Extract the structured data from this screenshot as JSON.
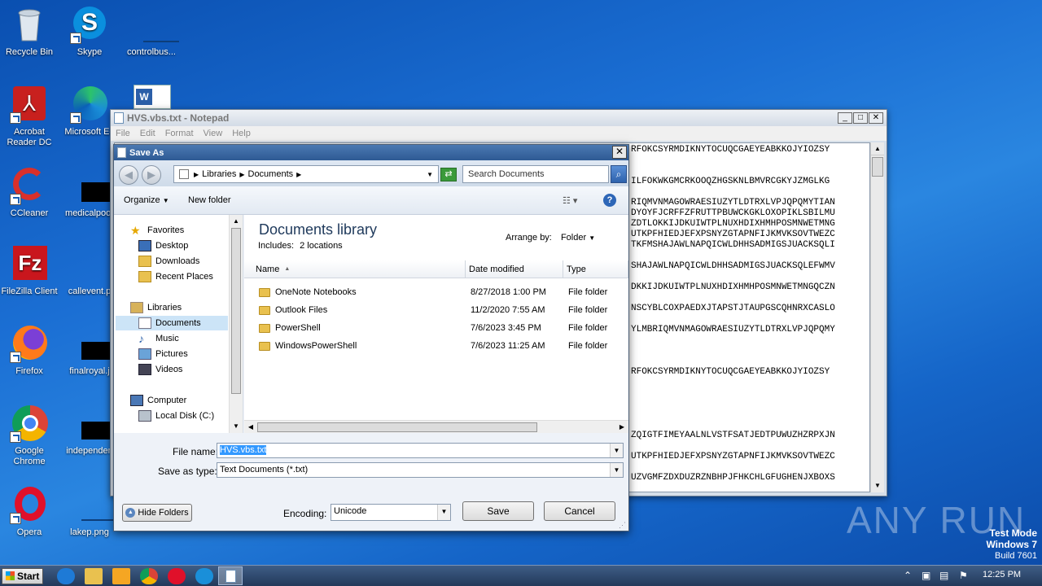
{
  "desktop": {
    "icons": [
      {
        "label": "Recycle Bin",
        "icon": "recycle-bin-icon"
      },
      {
        "label": "Skype",
        "icon": "skype-icon"
      },
      {
        "label": "controlbus...",
        "icon": "file-icon"
      },
      {
        "label": "Acrobat Reader DC",
        "icon": "acrobat-icon"
      },
      {
        "label": "Microsoft Ed",
        "icon": "edge-icon"
      },
      {
        "label": "CCleaner",
        "icon": "ccleaner-icon"
      },
      {
        "label": "medicalpoor",
        "icon": "file-icon"
      },
      {
        "label": "FileZilla Client",
        "icon": "filezilla-icon"
      },
      {
        "label": "callevent.p",
        "icon": "file-icon"
      },
      {
        "label": "Firefox",
        "icon": "firefox-icon"
      },
      {
        "label": "finalroyal.j",
        "icon": "file-icon"
      },
      {
        "label": "Google Chrome",
        "icon": "chrome-icon"
      },
      {
        "label": "independen",
        "icon": "file-icon"
      },
      {
        "label": "Opera",
        "icon": "opera-icon"
      },
      {
        "label": "lakep.png",
        "icon": "file-icon"
      }
    ],
    "watermark": {
      "brand": "ANY RUN",
      "line1": "Test Mode",
      "line2": "Windows 7",
      "line3": "Build 7601"
    }
  },
  "notepad": {
    "title": "HVS.vbs.txt - Notepad",
    "menu": [
      "File",
      "Edit",
      "Format",
      "View",
      "Help"
    ],
    "lines": [
      "RFOKCSYRMDIKNYTOCUQCGAEYEABKKOJYIOZSY",
      "",
      "",
      "ILFOKWKGMCRKOOQZHGSKNLBMVRCGKYJZMGLKG",
      "",
      "RIQMVNMAGOWRAESIUZYTLDTRXLVPJQPQMYTIAN",
      "DYOYFJCRFFZFRUTTPBUWCKGKLOXOPIKLSBILMU",
      "ZDTLOKKIJDKUIWTPLNUXHDIXHMHPOSMNWETMNG",
      "UTKPFHIEDJEFXPSNYZGTAPNFIJKMVKSOVTWEZC",
      "TKFMSHAJAWLNAPQICWLDHHSADMIGSJUACKSQLI",
      "",
      "SHAJAWLNAPQICWLDHHSADMIGSJUACKSQLEFWMV",
      "",
      "DKKIJDKUIWTPLNUXHDIXHMHPOSMNWETMNGQCZN",
      "",
      "NSCYBLCOXPAEDXJTAPSTJTAUPGSCQHNRXCASLO",
      "",
      "YLMBRIQMVNMAGOWRAESIUZYTLDTRXLVPJQPQMY",
      "",
      "",
      "",
      "RFOKCSYRMDIKNYTOCUQCGAEYEABKKOJYIOZSY",
      "",
      "",
      "",
      "",
      "",
      "ZQIGTFIMEYAALNLVSTFSATJEDTPUWUZHZRPXJN",
      "",
      "UTKPFHIEDJEFXPSNYZGTAPNFIJKMVKSOVTWEZC",
      "",
      "UZVGMFZDXDUZRZNBHPJFHKCHLGFUGHENJXBOXS"
    ]
  },
  "dialog": {
    "title": "Save As",
    "breadcrumb": {
      "root": "Libraries",
      "current": "Documents"
    },
    "search_placeholder": "Search Documents",
    "organize": "Organize",
    "new_folder": "New folder",
    "nav": {
      "favorites": "Favorites",
      "favorite_items": [
        "Desktop",
        "Downloads",
        "Recent Places"
      ],
      "libraries": "Libraries",
      "library_items": [
        "Documents",
        "Music",
        "Pictures",
        "Videos"
      ],
      "computer": "Computer",
      "computer_items": [
        "Local Disk (C:)"
      ]
    },
    "library": {
      "title": "Documents library",
      "includes_label": "Includes:",
      "includes_value": "2 locations",
      "arrange_label": "Arrange by:",
      "arrange_value": "Folder"
    },
    "columns": [
      "Name",
      "Date modified",
      "Type"
    ],
    "files": [
      {
        "name": "OneNote Notebooks",
        "date": "8/27/2018 1:00 PM",
        "type": "File folder"
      },
      {
        "name": "Outlook Files",
        "date": "11/2/2020 7:55 AM",
        "type": "File folder"
      },
      {
        "name": "PowerShell",
        "date": "7/6/2023 3:45 PM",
        "type": "File folder"
      },
      {
        "name": "WindowsPowerShell",
        "date": "7/6/2023 11:25 AM",
        "type": "File folder"
      }
    ],
    "filename_label": "File name:",
    "filename_value": "HVS.vbs.txt",
    "savetype_label": "Save as type:",
    "savetype_value": "Text Documents (*.txt)",
    "hide_folders": "Hide Folders",
    "encoding_label": "Encoding:",
    "encoding_value": "Unicode",
    "save": "Save",
    "cancel": "Cancel"
  },
  "taskbar": {
    "start": "Start",
    "time": "12:25 PM"
  }
}
